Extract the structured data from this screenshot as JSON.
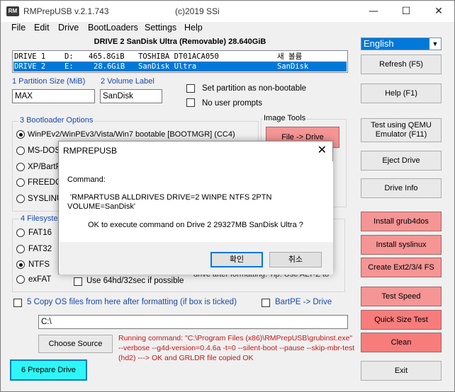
{
  "window": {
    "icon_text": "RM",
    "title": "RMPrepUSB  v.2.1.743",
    "copyright": "(c)2019 SSi",
    "minimize": "—",
    "maximize": "☐",
    "close": "✕"
  },
  "menu": [
    "File",
    "Edit",
    "Drive",
    "BootLoaders",
    "Settings",
    "Help"
  ],
  "drive_header": "DRIVE 2 SanDisk Ultra  (Removable) 28.640GiB",
  "drives": [
    {
      "name": "DRIVE 1",
      "letter": "D:",
      "size": "465.8GiB",
      "model": "TOSHIBA DT01ACA050",
      "label": "새 볼륨",
      "selected": false
    },
    {
      "name": "DRIVE 2",
      "letter": "E:",
      "size": "28.6GiB",
      "model": "SanDisk Ultra",
      "label": "SanDisk",
      "selected": true
    }
  ],
  "language": {
    "value": "English",
    "arrow": "▼"
  },
  "partition": {
    "label": "1 Partition Size (MiB)",
    "value": "MAX"
  },
  "volume": {
    "label": "2 Volume Label",
    "value": "SanDisk"
  },
  "options": {
    "non_bootable": "Set partition as non-bootable",
    "no_prompts": "No user prompts"
  },
  "bootloader": {
    "title": "3 Bootloader Options",
    "opt1": "WinPEv2/WinPEv3/Vista/Win7 bootable [BOOTMGR] (CC4)",
    "opt2": "MS-DOS",
    "opt3": "XP/BartP",
    "opt4": "FREEDO",
    "opt5": "SYSLINU"
  },
  "image_tools": {
    "title": "Image Tools",
    "file_to_drive": "File -> Drive"
  },
  "filesystem": {
    "title": "4 Filesyste",
    "fat16": "FAT16",
    "fat32": "FAT32",
    "ntfs": "NTFS",
    "exfat": "exFAT",
    "hd32": "Use 64hd/32sec if possible",
    "note": "drive after formatting. Tip: Use ALT-Z to"
  },
  "copy_os": {
    "label": "5 Copy OS files from here after formatting (if box is ticked)",
    "bartpe": "BartPE -> Drive",
    "path": "C:\\"
  },
  "choose_source": "Choose Source",
  "prepare_drive": "6 Prepare Drive",
  "status_text": "Running command: \"C:\\Program Files (x86)\\RMPrepUSB\\grubinst.exe\" --verbose --g4d-version=0.4.6a -t=0 --silent-boot --pause  --skip-mbr-test (hd2) ---> OK and GRLDR file copied OK",
  "right_buttons": {
    "refresh": "Refresh (F5)",
    "help": "Help (F1)",
    "qemu1": "Test using QEMU",
    "qemu2": "Emulator (F11)",
    "eject": "Eject Drive",
    "info": "Drive Info",
    "grub4dos": "Install grub4dos",
    "syslinux": "Install syslinux",
    "ext": "Create Ext2/3/4 FS",
    "speed": "Test Speed",
    "quick": "Quick Size Test",
    "clean": "Clean",
    "exit": "Exit"
  },
  "dialog": {
    "title": "RMPREPUSB",
    "close": "✕",
    "command_label": "Command:",
    "command_line1": "'RMPARTUSB  ALLDRIVES DRIVE=2 WINPE NTFS 2PTN",
    "command_line2": "VOLUME=SanDisk'",
    "question": "OK to execute command on Drive 2 29327MB SanDisk Ultra ?",
    "ok": "확인",
    "cancel": "취소"
  }
}
